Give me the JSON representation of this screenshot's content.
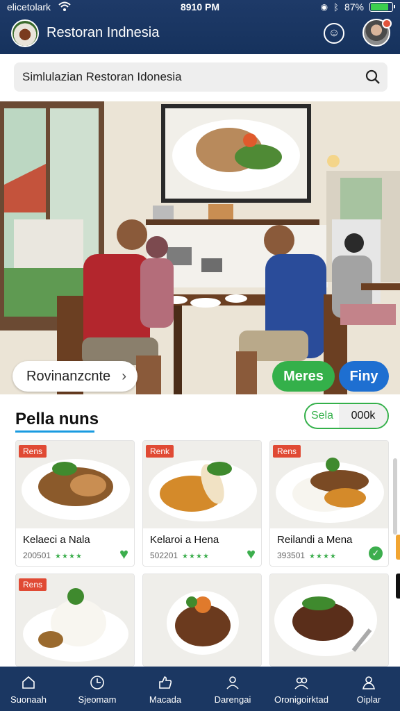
{
  "status_bar": {
    "carrier": "elicetolark",
    "time": "8910 PM",
    "battery": "87%",
    "battery_level": 0.87
  },
  "header": {
    "title": "Restoran Indnesia"
  },
  "search": {
    "text": "Simlulazian Restoran Idonesia"
  },
  "hero": {
    "left_pill": "Rovinanzcnte",
    "green_pill": "Meres",
    "blue_pill": "Finy"
  },
  "section": {
    "title": "Pella nuns",
    "toggle_on": "Sela",
    "toggle_off": "000k"
  },
  "cards": [
    {
      "badge": "Rens",
      "name": "Kelaeci a Nala",
      "meta": "200501",
      "stars": "★★★★",
      "status": "favorite"
    },
    {
      "badge": "Renk",
      "name": "Kelaroi a Hena",
      "meta": "502201",
      "stars": "★★★★",
      "status": "favorite"
    },
    {
      "badge": "Rens",
      "name": "Reilandi a Mena",
      "meta": "393501",
      "stars": "★★★★",
      "status": "selected"
    },
    {
      "badge": "Rens",
      "name": "",
      "meta": "",
      "stars": "",
      "status": "none"
    },
    {
      "badge": "",
      "name": "",
      "meta": "",
      "stars": "",
      "status": "none"
    },
    {
      "badge": "",
      "name": "",
      "meta": "",
      "stars": "",
      "status": "none"
    }
  ],
  "bottom_nav": [
    {
      "label": "Suonaah",
      "icon": "home-icon"
    },
    {
      "label": "Sjeomam",
      "icon": "compass-icon"
    },
    {
      "label": "Macada",
      "icon": "thumb-icon"
    },
    {
      "label": "Darengai",
      "icon": "person-icon"
    },
    {
      "label": "Oronigoirktad",
      "icon": "group-icon"
    },
    {
      "label": "Oiplar",
      "icon": "profile-icon"
    }
  ],
  "colors": {
    "primary": "#1b3762",
    "accent_green": "#34b04a",
    "accent_blue": "#1e6fd1",
    "badge_red": "#e04a34",
    "underline_blue": "#1a9be0"
  }
}
